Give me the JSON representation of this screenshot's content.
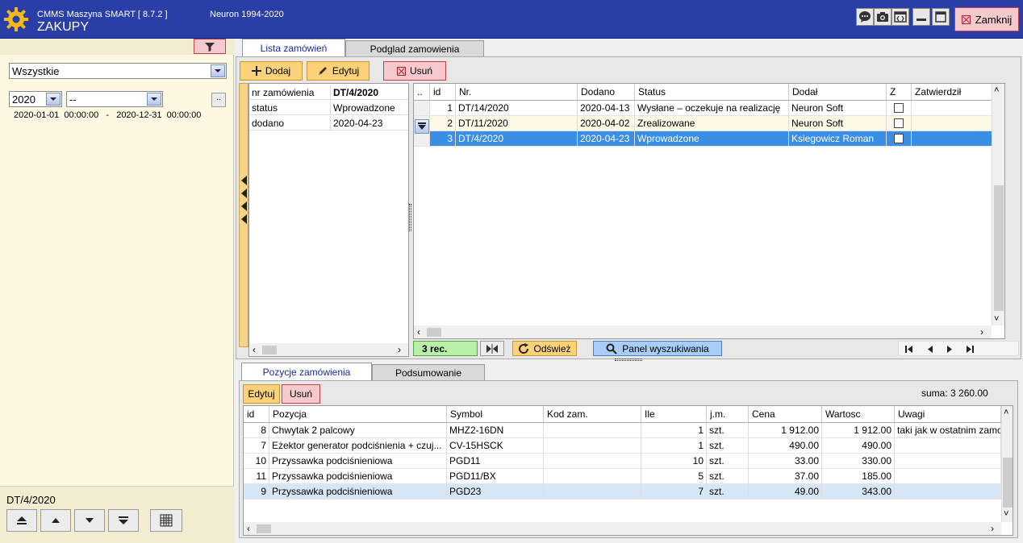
{
  "title_bar": {
    "app_name": "CMMS Maszyna SMART  [ 8.7.2 ]",
    "module": "ZAKUPY",
    "copyright": "Neuron 1994-2020",
    "close_label": "Zamknij"
  },
  "colors": {
    "title_bar": "#2a3ea8",
    "selected_row": "#3a8ee6",
    "accent_yellow": "#fbd27a",
    "accent_red": "#f6c9cc"
  },
  "left_panel": {
    "status_filter": "Wszystkie",
    "year": "2020",
    "month": "--",
    "dots": "..",
    "date_range": "2020-01-01  00:00:00   -   2020-12-31  00:00:00",
    "selected_code": "DT/4/2020"
  },
  "main_tabs": [
    {
      "label": "Lista zamówień"
    },
    {
      "label": "Podglad zamowienia"
    }
  ],
  "toolbar": {
    "add": "Dodaj",
    "edit": "Edytuj",
    "delete": "Usuń"
  },
  "details": [
    {
      "key": "nr zamówienia",
      "value": "DT/4/2020"
    },
    {
      "key": "status",
      "value": "Wprowadzone"
    },
    {
      "key": "dodano",
      "value": "2020-04-23"
    }
  ],
  "orders": {
    "columns": [
      "..",
      "id",
      "Nr.",
      "Dodano",
      "Status",
      "Dodał",
      "Z",
      "Zatwierdził"
    ],
    "rows": [
      {
        "id": "1",
        "nr": "DT/14/2020",
        "dodano": "2020-04-13",
        "status": "Wysłane – oczekuje na realizację",
        "dodal": "Neuron Soft",
        "zatwierdzil": ""
      },
      {
        "id": "2",
        "nr": "DT/11/2020",
        "dodano": "2020-04-02",
        "status": "Zrealizowane",
        "dodal": "Neuron Soft",
        "zatwierdzil": ""
      },
      {
        "id": "3",
        "nr": "DT/4/2020",
        "dodano": "2020-04-23",
        "status": "Wprowadzone",
        "dodal": "Ksiegowicz Roman",
        "zatwierdzil": ""
      }
    ],
    "record_count": "3 rec.",
    "refresh": "Odśwież",
    "search_panel": "Panel wyszukiwania"
  },
  "sub_tabs": [
    {
      "label": "Pozycje zamówienia"
    },
    {
      "label": "Podsumowanie"
    }
  ],
  "items_toolbar": {
    "edit": "Edytuj",
    "delete": "Usuń",
    "sum": "suma: 3 260.00"
  },
  "items": {
    "columns": [
      "id",
      "Pozycja",
      "Symbol",
      "Kod zam.",
      "Ile",
      "j.m.",
      "Cena",
      "Wartosc",
      "Uwagi"
    ],
    "rows": [
      {
        "id": "8",
        "pozycja": "Chwytak 2 palcowy",
        "symbol": "MHZ2-16DN",
        "kod": "",
        "ile": "1",
        "jm": "szt.",
        "cena": "1 912.00",
        "wartosc": "1 912.00",
        "uwagi": "taki jak w ostatnim zamo"
      },
      {
        "id": "7",
        "pozycja": "Eżektor generator podciśnienia + czuj...",
        "symbol": "CV-15HSCK",
        "kod": "",
        "ile": "1",
        "jm": "szt.",
        "cena": "490.00",
        "wartosc": "490.00",
        "uwagi": ""
      },
      {
        "id": "10",
        "pozycja": "Przyssawka podciśnieniowa",
        "symbol": "PGD11",
        "kod": "",
        "ile": "10",
        "jm": "szt.",
        "cena": "33.00",
        "wartosc": "330.00",
        "uwagi": ""
      },
      {
        "id": "11",
        "pozycja": "Przyssawka podciśnieniowa",
        "symbol": "PGD11/BX",
        "kod": "",
        "ile": "5",
        "jm": "szt.",
        "cena": "37.00",
        "wartosc": "185.00",
        "uwagi": ""
      },
      {
        "id": "9",
        "pozycja": "Przyssawka podciśnieniowa",
        "symbol": "PGD23",
        "kod": "",
        "ile": "7",
        "jm": "szt.",
        "cena": "49.00",
        "wartosc": "343.00",
        "uwagi": ""
      }
    ]
  }
}
